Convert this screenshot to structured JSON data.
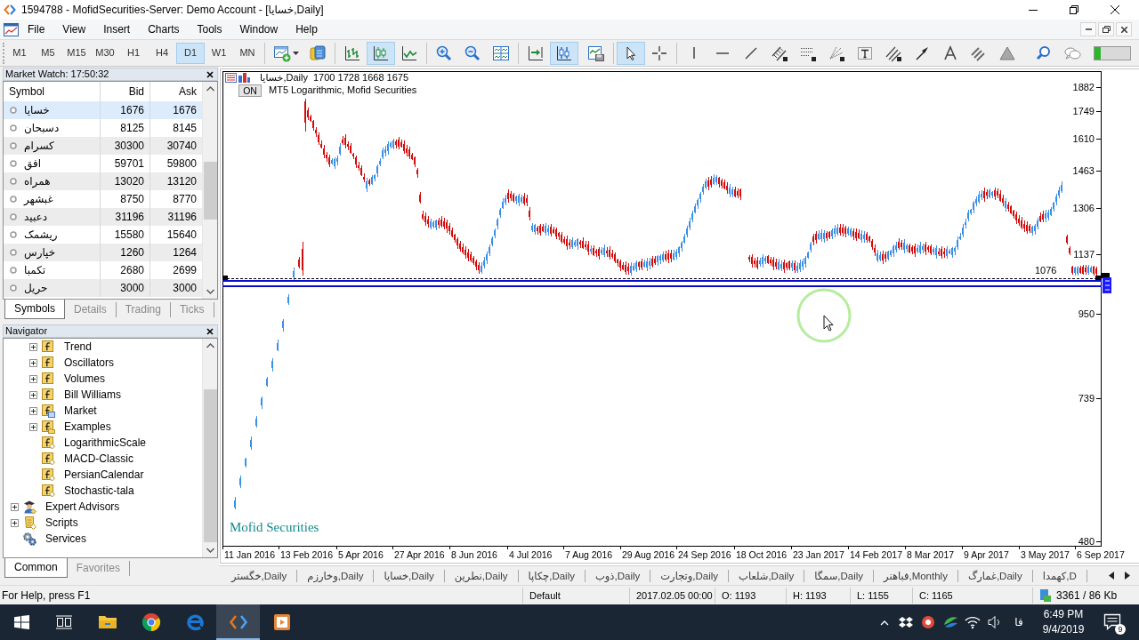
{
  "window": {
    "title": "1594788 - MofidSecurities-Server: Demo Account - [خسایا,Daily]"
  },
  "menu": [
    "File",
    "View",
    "Insert",
    "Charts",
    "Tools",
    "Window",
    "Help"
  ],
  "timeframes": [
    {
      "label": "M1",
      "selected": false
    },
    {
      "label": "M5",
      "selected": false
    },
    {
      "label": "M15",
      "selected": false
    },
    {
      "label": "M30",
      "selected": false
    },
    {
      "label": "H1",
      "selected": false
    },
    {
      "label": "H4",
      "selected": false
    },
    {
      "label": "D1",
      "selected": true
    },
    {
      "label": "W1",
      "selected": false
    },
    {
      "label": "MN",
      "selected": false
    }
  ],
  "toolbar": [
    {
      "on": false
    },
    {
      "on": false
    },
    {
      "on": false
    },
    {
      "on": true
    },
    {
      "on": false
    },
    {
      "on": false
    },
    {
      "on": false
    },
    {
      "on": false
    },
    {
      "on": false
    },
    {
      "on": true
    },
    {
      "on": false
    },
    {
      "on": true
    },
    {
      "on": false
    },
    {
      "on": false
    },
    {
      "on": false
    },
    {
      "on": false
    },
    {
      "on": false
    },
    {
      "on": false
    },
    {
      "on": false
    },
    {
      "on": false
    },
    {
      "on": false
    },
    {
      "on": false
    },
    {
      "on": false
    },
    {
      "on": false
    },
    {
      "on": false
    },
    {
      "on": false
    },
    {
      "on": false
    }
  ],
  "market_watch": {
    "title": "Market Watch: 17:50:32",
    "columns": [
      "Symbol",
      "Bid",
      "Ask"
    ],
    "rows": [
      {
        "symbol": "خسایا",
        "bid": "1676",
        "ask": "1676",
        "selected": true
      },
      {
        "symbol": "دسبحان",
        "bid": "8125",
        "ask": "8145",
        "selected": false
      },
      {
        "symbol": "کسرام",
        "bid": "30300",
        "ask": "30740",
        "selected": false
      },
      {
        "symbol": "افق",
        "bid": "59701",
        "ask": "59800",
        "selected": false
      },
      {
        "symbol": "همراه",
        "bid": "13020",
        "ask": "13120",
        "selected": false
      },
      {
        "symbol": "غبشهر",
        "bid": "8750",
        "ask": "8770",
        "selected": false
      },
      {
        "symbol": "دعبید",
        "bid": "31196",
        "ask": "31196",
        "selected": false
      },
      {
        "symbol": "ریشمک",
        "bid": "15580",
        "ask": "15640",
        "selected": false
      },
      {
        "symbol": "خپارس",
        "bid": "1260",
        "ask": "1264",
        "selected": false
      },
      {
        "symbol": "تکمبا",
        "bid": "2680",
        "ask": "2699",
        "selected": false
      },
      {
        "symbol": "حریل",
        "bid": "3000",
        "ask": "3000",
        "selected": false
      }
    ],
    "tabs": [
      {
        "label": "Symbols",
        "selected": true
      },
      {
        "label": "Details",
        "selected": false
      },
      {
        "label": "Trading",
        "selected": false
      },
      {
        "label": "Ticks",
        "selected": false
      }
    ]
  },
  "navigator": {
    "title": "Navigator",
    "items": [
      {
        "children": [
          {
            "label": "Trend",
            "kind": "indicator-folder",
            "expanded": false
          },
          {
            "label": "Oscillators",
            "kind": "indicator-folder",
            "expanded": false
          },
          {
            "label": "Volumes",
            "kind": "indicator-folder",
            "expanded": false
          },
          {
            "label": "Bill Williams",
            "kind": "indicator-folder",
            "expanded": false
          },
          {
            "label": "Market",
            "kind": "market",
            "expanded": false
          },
          {
            "label": "Examples",
            "kind": "examples",
            "expanded": false
          },
          {
            "label": "LogarithmicScale",
            "kind": "indicator"
          },
          {
            "label": "MACD-Classic",
            "kind": "indicator"
          },
          {
            "label": "PersianCalendar",
            "kind": "indicator"
          },
          {
            "label": "Stochastic-tala",
            "kind": "indicator"
          }
        ]
      },
      {
        "label": "Expert Advisors",
        "kind": "experts",
        "expanded": false
      },
      {
        "label": "Scripts",
        "kind": "scripts",
        "expanded": false
      },
      {
        "label": "Services",
        "kind": "services"
      }
    ],
    "tabs": [
      {
        "label": "Common",
        "selected": true
      },
      {
        "label": "Favorites",
        "selected": false
      }
    ]
  },
  "chart": {
    "symbol": "خسایا,Daily",
    "ohlc": "1700 1728 1668 1675",
    "button": "ON",
    "expert": "MT5 Logarithmic, Mofid Securities",
    "caption": "Mofid Securities",
    "price_labels": [
      "1882",
      "1749",
      "1610",
      "1463",
      "1306",
      "1137",
      "950",
      "739",
      "480"
    ],
    "line_label": "1076",
    "date_labels": [
      "11 Jan 2016",
      "13 Feb 2016",
      "5 Apr 2016",
      "27 Apr 2016",
      "8 Jun 2016",
      "4 Jul 2016",
      "7 Aug 2016",
      "29 Aug 2016",
      "24 Sep 2016",
      "18 Oct 2016",
      "23 Jan 2017",
      "14 Feb 2017",
      "8 Mar 2017",
      "9 Apr 2017",
      "3 May 2017",
      "6 Sep 2017"
    ]
  },
  "chart_tabs": [
    "خگستر,Daily",
    "وخارزم,Daily",
    "خسایا,Daily",
    "نطرین,Daily",
    "چکاپا,Daily",
    "ذوب,Daily",
    "وتجارت,Daily",
    "شلعاب,Daily",
    "سمگا,Daily",
    "فباهنر,Monthly",
    "غمارگ,Daily",
    "کهمدا,D"
  ],
  "status_bar": {
    "help": "For Help, press F1",
    "profile": "Default",
    "time": "2017.02.05 00:00",
    "open": "O: 1193",
    "high": "H: 1193",
    "low": "L: 1155",
    "close": "C: 1165",
    "traffic": "3361 / 86 Kb"
  },
  "taskbar": {
    "apps": [
      {
        "active": false
      },
      {
        "active": false
      },
      {
        "active": false
      },
      {
        "active": true
      },
      {
        "active": false
      }
    ],
    "language": "فا",
    "time": "6:49 PM",
    "date": "9/4/2019",
    "notifications": "9"
  }
}
